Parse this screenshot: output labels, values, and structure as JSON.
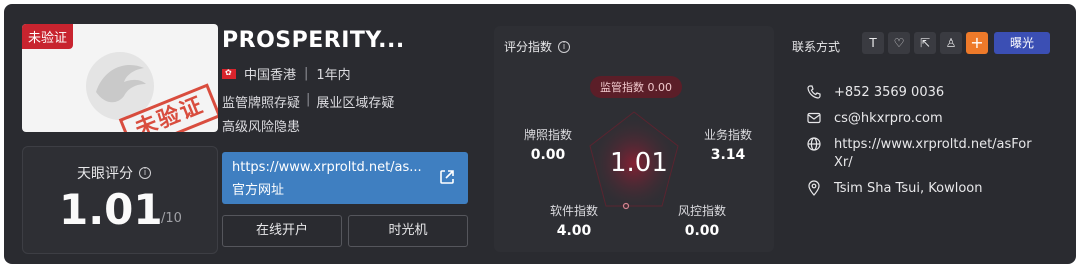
{
  "broker": {
    "name": "PROSPERITY...",
    "unverified_tag": "未验证",
    "stamp_text": "未验证",
    "region": "中国香港",
    "years": "1年内",
    "doubt_1": "监管牌照存疑",
    "doubt_2": "展业区域存疑",
    "risk": "高级风险隐患"
  },
  "score": {
    "label": "天眼评分",
    "value": "1.01",
    "max": "/10"
  },
  "website": {
    "url": "https://www.xrproltd.net/as...",
    "label": "官方网址"
  },
  "buttons": {
    "open_account": "在线开户",
    "time_machine": "时光机"
  },
  "rating": {
    "title": "评分指数",
    "regulation_pill": "监管指数 0.00",
    "center_value": "1.01",
    "metrics": {
      "license": {
        "label": "牌照指数",
        "value": "0.00"
      },
      "business": {
        "label": "业务指数",
        "value": "3.14"
      },
      "software": {
        "label": "软件指数",
        "value": "4.00"
      },
      "risk_control": {
        "label": "风控指数",
        "value": "0.00"
      }
    }
  },
  "contact": {
    "title": "联系方式",
    "expose_label": "曝光",
    "phone": "+852 3569 0036",
    "email": "cs@hkxrpro.com",
    "website": "https://www.xrproltd.net/asForXr/",
    "address": "Tsim Sha Tsui, Kowloon"
  },
  "colors": {
    "background": "#2a2b30",
    "accent_blue": "#3f7fc1",
    "warning_red": "#c8242f",
    "orange": "#ee7a2a",
    "expose_blue": "#3b4fb4"
  }
}
